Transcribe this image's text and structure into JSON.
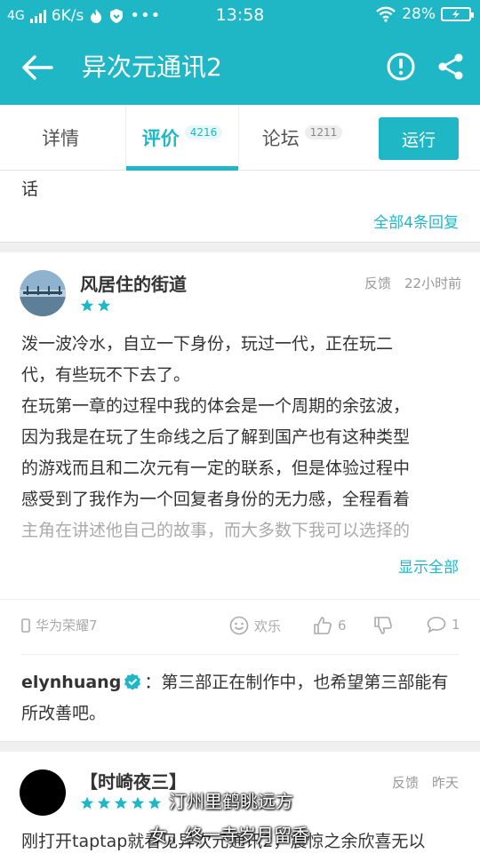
{
  "status_bar": {
    "network": "4G",
    "speed": "6K/s",
    "time": "13:58",
    "battery": "28%"
  },
  "app_bar": {
    "title": "异次元通讯2"
  },
  "tabs": [
    {
      "label": "详情",
      "count": ""
    },
    {
      "label": "评价",
      "count": "4216"
    },
    {
      "label": "论坛",
      "count": "1211"
    }
  ],
  "run_button": "运行",
  "previous_review": {
    "tail_text": "话",
    "all_replies": "全部4条回复"
  },
  "review": {
    "username": "风居住的街道",
    "stars": 2,
    "feedback": "反馈",
    "time": "22小时前",
    "lines": [
      "泼一波冷水，自立一下身份，玩过一代，正在玩二",
      "代，有些玩不下去了。",
      "在玩第一章的过程中我的体会是一个周期的余弦波，",
      "因为我是在玩了生命线之后了解到国产也有这种类型",
      "的游戏而且和二次元有一定的联系，但是体验过程中",
      "感受到了我作为一个回复者身份的无力感，全程看着",
      "主角在讲述他自己的故事，而大多数下我可以选择的"
    ],
    "show_all": "显示全部",
    "device": "华为荣耀7",
    "mood": "欢乐",
    "likes": "6",
    "comments": "1",
    "reply_user": "elynhuang",
    "reply_text": "：第三部正在制作中，也希望第三部能有",
    "reply_text_2": "所改善吧。"
  },
  "review2": {
    "username": "【时崎夜三】",
    "stars": 5,
    "feedback": "反馈",
    "time": "昨天",
    "first_line": "刚打开taptap就看见异次元通讯2，震惊之余欣喜无以"
  },
  "subtitles": {
    "line1": "汀州里鹤眺远方",
    "line2": "女，终一寺岁月留香"
  },
  "colors": {
    "accent": "#1fb7c6",
    "text": "#333333",
    "muted": "#999999"
  }
}
